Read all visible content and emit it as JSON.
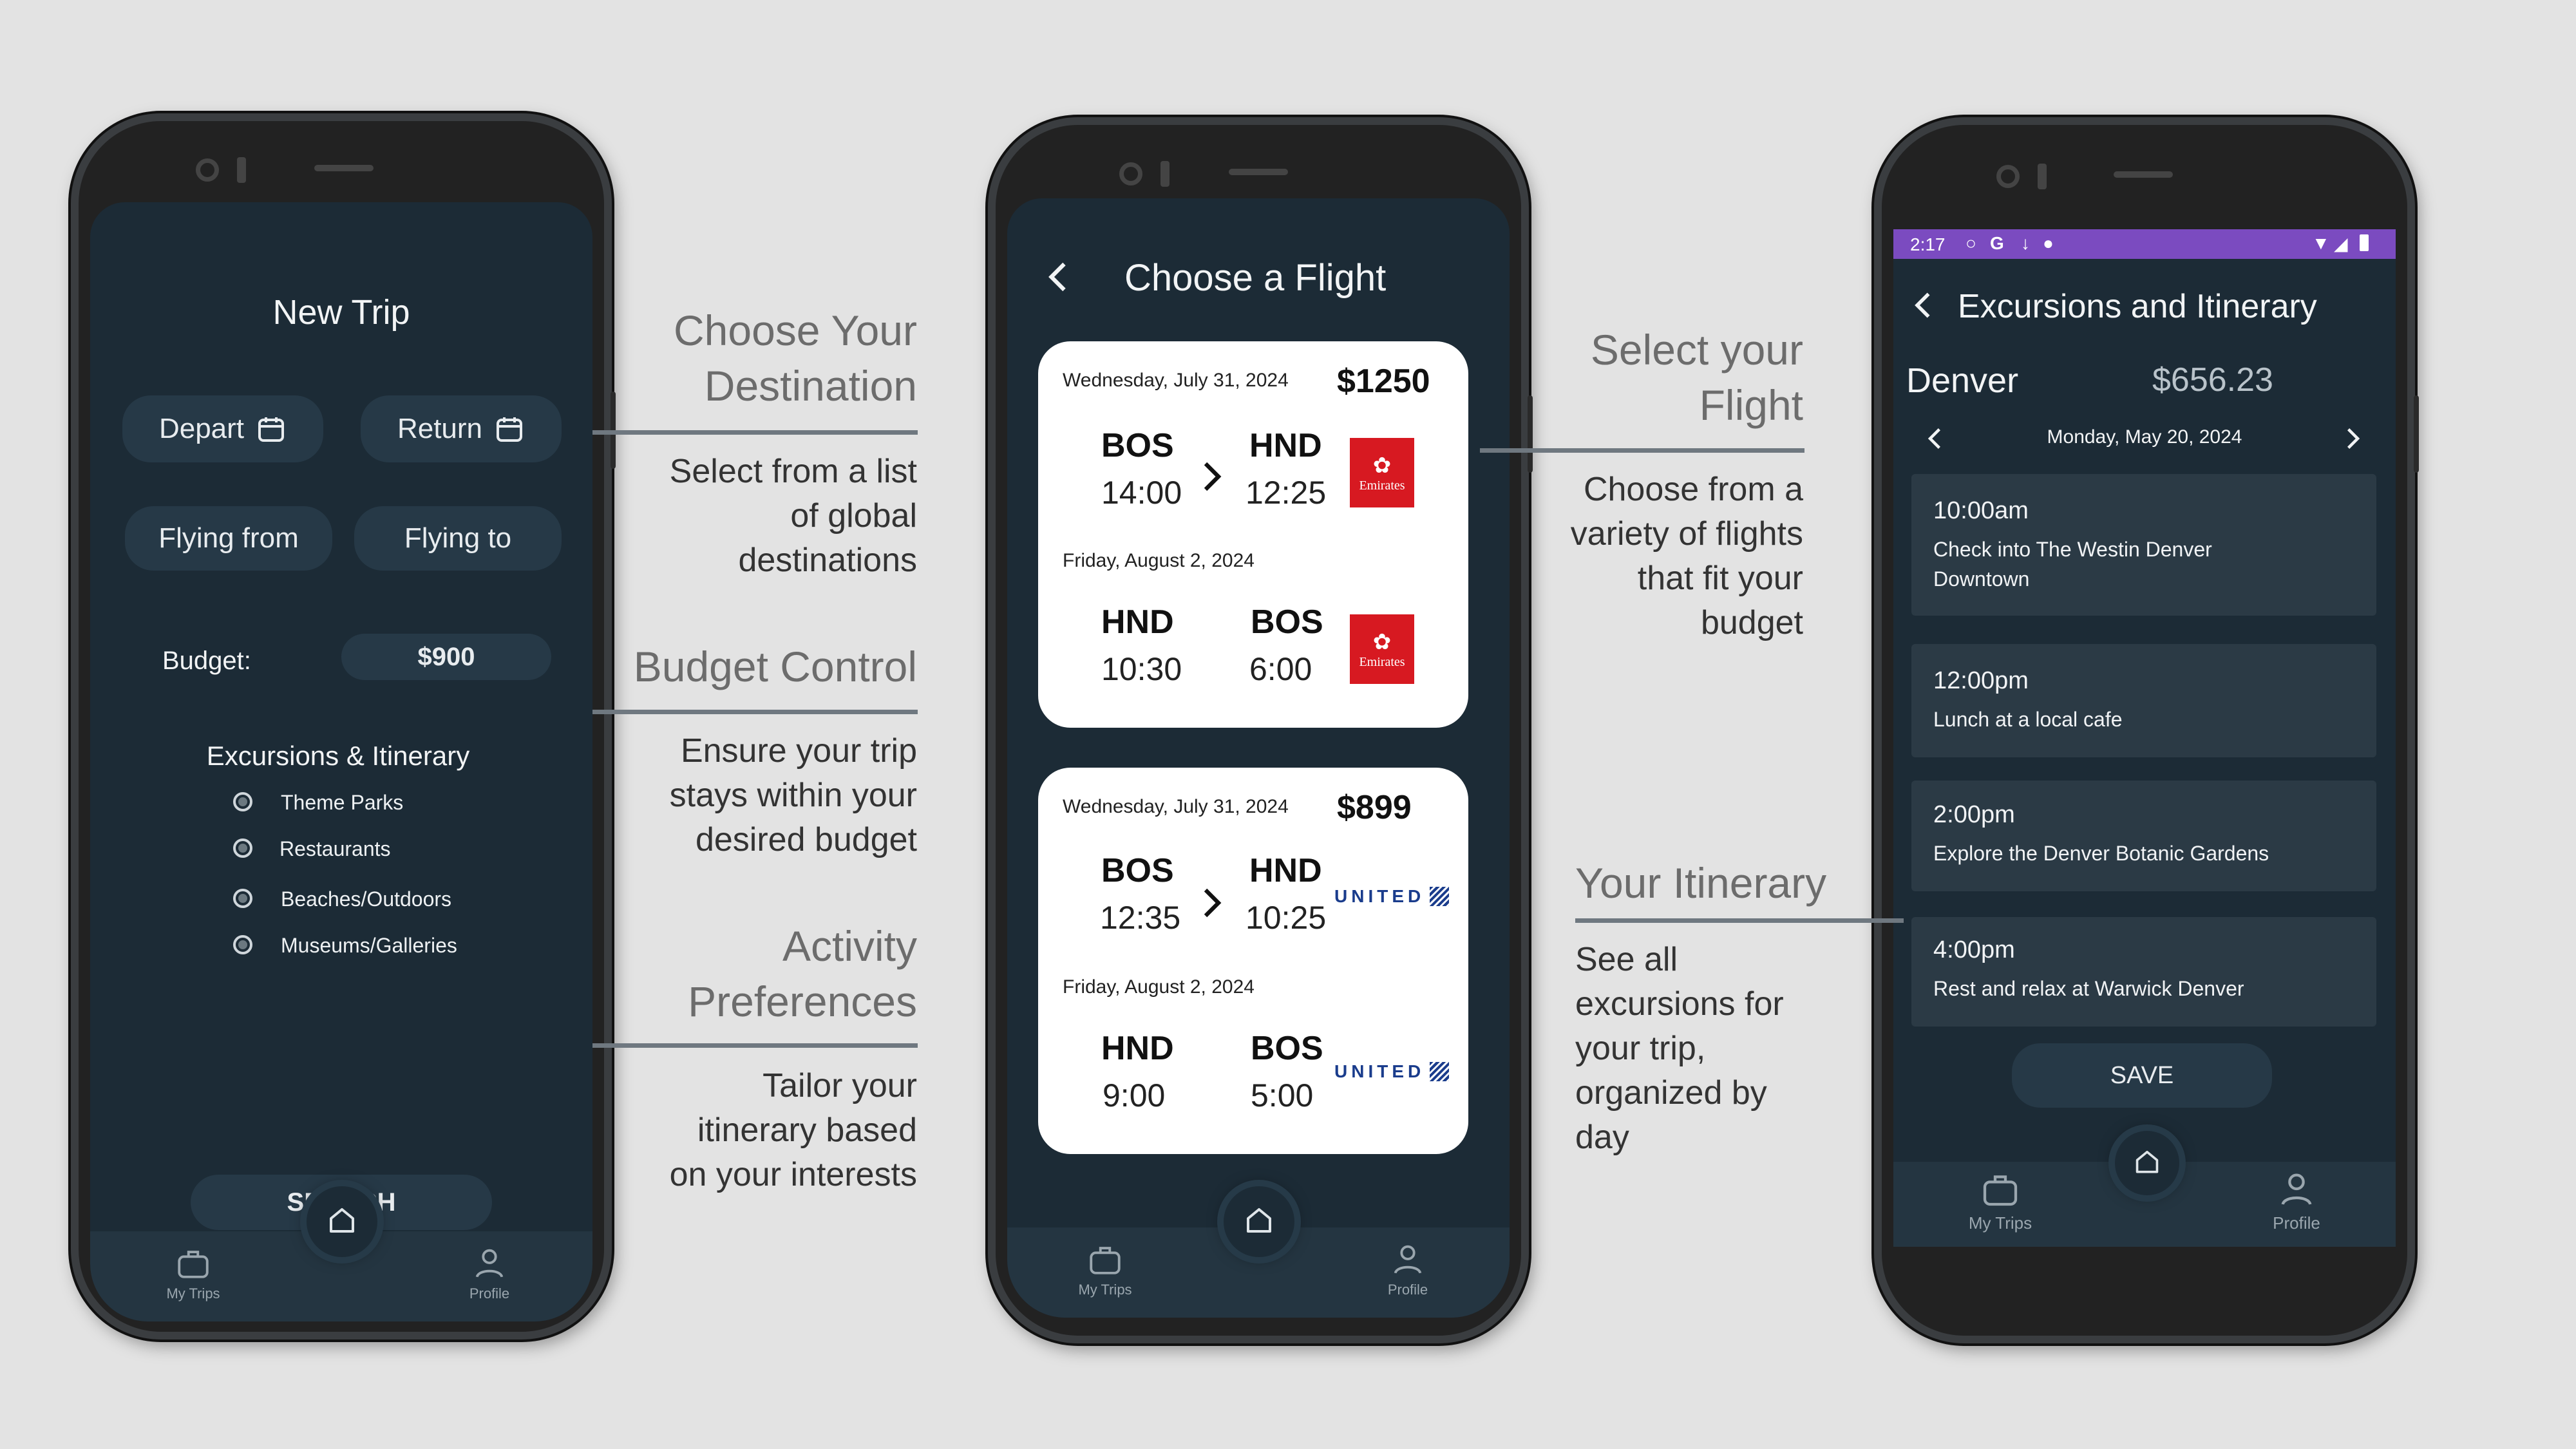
{
  "screen1": {
    "title": "New Trip",
    "depart_label": "Depart",
    "return_label": "Return",
    "flying_from_label": "Flying from",
    "flying_to_label": "Flying to",
    "budget_label": "Budget:",
    "budget_value": "$900",
    "section_title": "Excursions & Itinerary",
    "options": [
      "Theme Parks",
      "Restaurants",
      "Beaches/Outdoors",
      "Museums/Galleries"
    ],
    "search_label": "SEARCH"
  },
  "screen2": {
    "title": "Choose a Flight",
    "cards": [
      {
        "price": "$1250",
        "outbound": {
          "date": "Wednesday, July 31, 2024",
          "from": "BOS",
          "to": "HND",
          "depart": "14:00",
          "arrive": "12:25"
        },
        "return": {
          "date": "Friday,  August 2, 2024",
          "from": "HND",
          "to": "BOS",
          "depart": "10:30",
          "arrive": "6:00"
        },
        "airline": "Emirates"
      },
      {
        "price": "$899",
        "outbound": {
          "date": "Wednesday, July 31, 2024",
          "from": "BOS",
          "to": "HND",
          "depart": "12:35",
          "arrive": "10:25"
        },
        "return": {
          "date": "Friday,  August 2, 2024",
          "from": "HND",
          "to": "BOS",
          "depart": "9:00",
          "arrive": "5:00"
        },
        "airline": "UNITED"
      }
    ]
  },
  "screen3": {
    "status_time": "2:17",
    "status_g": "G",
    "title": "Excursions and Itinerary",
    "city": "Denver",
    "total": "$656.23",
    "date": "Monday, May 20, 2024",
    "items": [
      {
        "time": "10:00am",
        "desc": "Check into The Westin Denver Downtown"
      },
      {
        "time": "12:00pm",
        "desc": "Lunch at a local cafe"
      },
      {
        "time": "2:00pm",
        "desc": "Explore the Denver Botanic Gardens"
      },
      {
        "time": "4:00pm",
        "desc": "Rest and relax at Warwick Denver"
      }
    ],
    "save_label": "SAVE"
  },
  "nav": {
    "my_trips": "My Trips",
    "profile": "Profile"
  },
  "annotations": {
    "destination": {
      "title": [
        "Choose Your",
        "Destination"
      ],
      "text": [
        "Select from a list",
        "of global",
        "destinations"
      ]
    },
    "budget": {
      "title": [
        "Budget Control"
      ],
      "text": [
        "Ensure your trip",
        "stays within your",
        "desired budget"
      ]
    },
    "activity": {
      "title": [
        "Activity",
        "Preferences"
      ],
      "text": [
        "Tailor your",
        "itinerary based",
        "on your interests"
      ]
    },
    "flight": {
      "title": [
        "Select your",
        "Flight"
      ],
      "text": [
        "Choose from a",
        "variety of flights",
        "that fit your",
        "budget"
      ]
    },
    "itinerary": {
      "title": [
        "Your Itinerary"
      ],
      "text": [
        "See all",
        "excursions for",
        "your trip,",
        "organized by",
        "day"
      ]
    }
  },
  "colors": {
    "screen_bg": "#1c2b36",
    "pill_bg": "#263947",
    "status_bar": "#7b4bc0",
    "emirates_red": "#d71921",
    "united_blue": "#1a3c8c"
  }
}
